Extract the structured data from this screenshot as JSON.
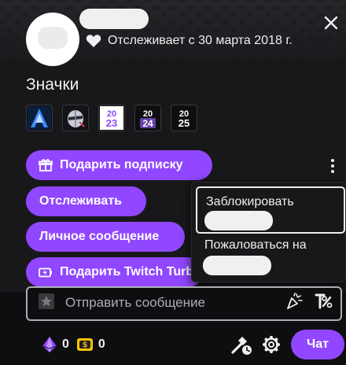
{
  "header": {
    "follow_text": "Отслеживает с 30 марта 2018 г."
  },
  "badges": {
    "title": "Значки",
    "items": [
      {
        "icon": "arrow-a-badge-icon"
      },
      {
        "icon": "knight-helmet-badge-icon"
      },
      {
        "icon": "2023-badge-icon",
        "line1": "20",
        "line2": "23"
      },
      {
        "icon": "2024-badge-icon",
        "line1": "20",
        "line2": "24"
      },
      {
        "icon": "2025-badge-icon",
        "line1": "20",
        "line2": "25"
      }
    ]
  },
  "actions": {
    "gift_label": "Подарить подписку",
    "follow_label": "Отслеживать",
    "whisper_label": "Личное сообщение",
    "turbo_label": "Подарить Twitch Turbo"
  },
  "menu": {
    "block_label": "Заблокировать",
    "report_label": "Пожаловаться на"
  },
  "chat": {
    "placeholder": "Отправить сообщение",
    "points_count": "0",
    "bits_count": "0",
    "send_label": "Чат"
  },
  "colors": {
    "accent": "#9147ff",
    "background": "#18181b",
    "text": "#efeff1"
  }
}
